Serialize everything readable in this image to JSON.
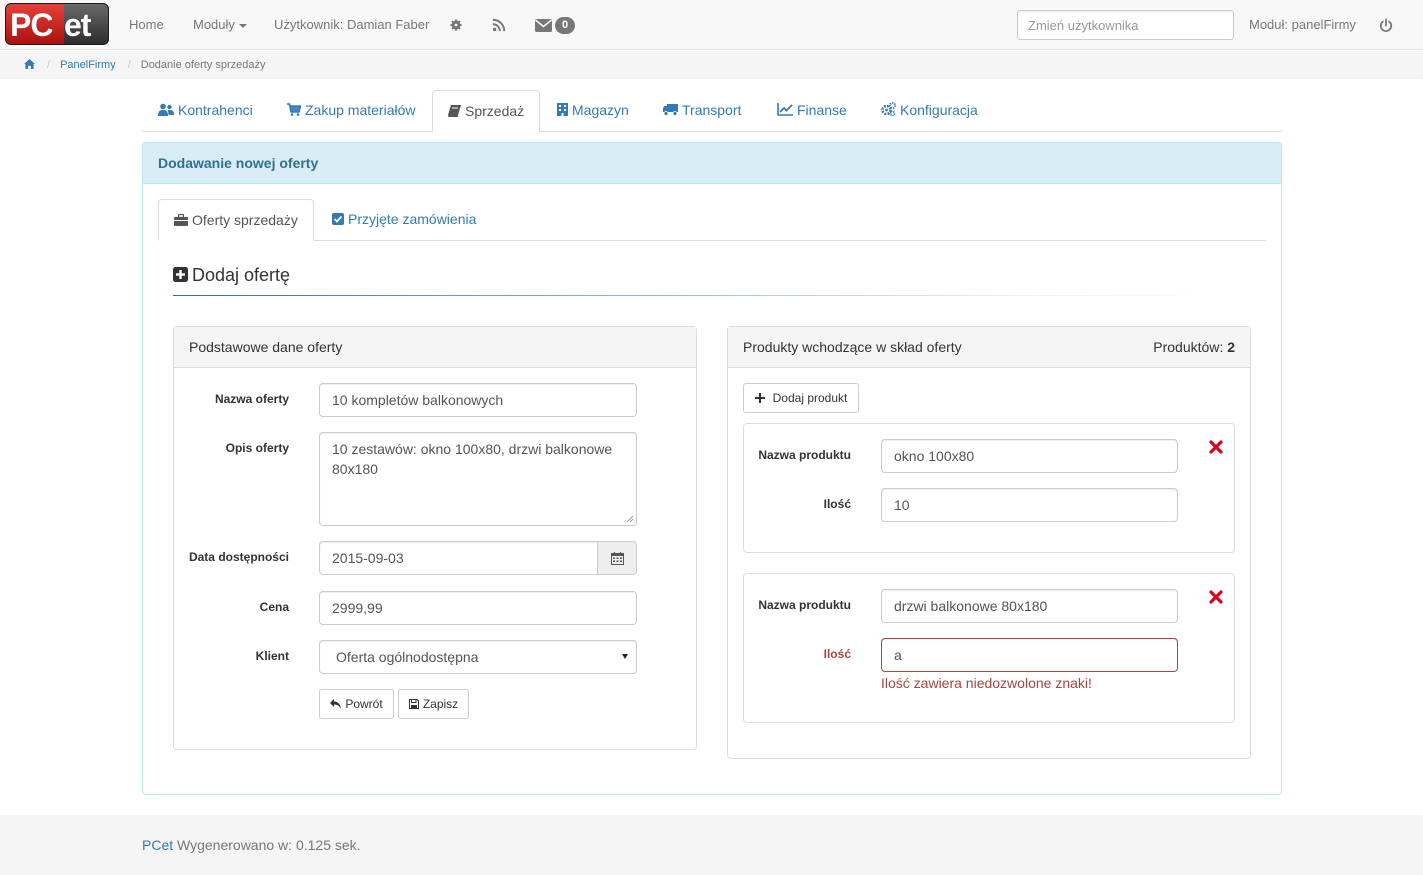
{
  "navbar": {
    "logo_left": "PC",
    "logo_right": "et",
    "home": "Home",
    "modules": "Moduły",
    "user": "Użytkownik: Damian Faber",
    "messages_count": "0",
    "change_user_placeholder": "Zmień użytkownika",
    "module_label": "Moduł: panelFirmy"
  },
  "breadcrumb": {
    "panel": "PanelFirmy",
    "current": "Dodanie oferty sprzedaży"
  },
  "main_tabs": [
    {
      "label": "Kontrahenci",
      "icon": "users-icon"
    },
    {
      "label": "Zakup materiałów",
      "icon": "cart-icon"
    },
    {
      "label": "Sprzedaż",
      "icon": "book-icon",
      "active": true
    },
    {
      "label": "Magazyn",
      "icon": "building-icon"
    },
    {
      "label": "Transport",
      "icon": "truck-icon"
    },
    {
      "label": "Finanse",
      "icon": "line-chart-icon"
    },
    {
      "label": "Konfiguracja",
      "icon": "cogs-icon"
    }
  ],
  "panel": {
    "heading": "Dodawanie nowej oferty",
    "sub_tabs": [
      {
        "label": "Oferty sprzedaży",
        "icon": "briefcase-icon",
        "active": true
      },
      {
        "label": "Przyjęte zamówienia",
        "icon": "check-square-icon"
      }
    ],
    "section_title": "Dodaj ofertę"
  },
  "basic_data": {
    "heading": "Podstawowe dane oferty",
    "name_label": "Nazwa oferty",
    "name_value": "10 kompletów balkonowych",
    "desc_label": "Opis oferty",
    "desc_value": "10 zestawów: okno 100x80, drzwi balkonowe 80x180",
    "date_label": "Data dostępności",
    "date_value": "2015-09-03",
    "price_label": "Cena",
    "price_value": "2999,99",
    "client_label": "Klient",
    "client_value": "Oferta ogólnodostępna",
    "back_button": "Powrót",
    "save_button": "Zapisz"
  },
  "products": {
    "heading": "Produkty wchodzące w skład oferty",
    "count_label": "Produktów:",
    "count": "2",
    "add_button": "Dodaj produkt",
    "items": [
      {
        "name_label": "Nazwa produktu",
        "name_value": "okno 100x80",
        "qty_label": "Ilość",
        "qty_value": "10"
      },
      {
        "name_label": "Nazwa produktu",
        "name_value": "drzwi balkonowe 80x180",
        "qty_label": "Ilość",
        "qty_value": "a",
        "error": "Ilość zawiera niedozwolone znaki!"
      }
    ]
  },
  "footer": {
    "brand": "PCet",
    "generated": "Wygenerowano w: 0.125 sek."
  },
  "colors": {
    "link": "#337ab7",
    "info_bg": "#d9edf7",
    "info_text": "#31708f",
    "error": "#a94442",
    "remove": "#d9001b"
  }
}
